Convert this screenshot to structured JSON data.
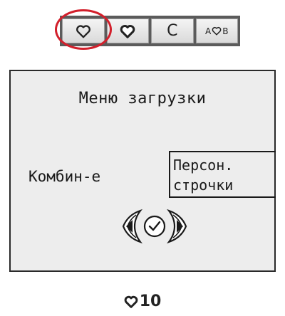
{
  "toolbar": {
    "keys": [
      {
        "icon": "heart-outline-icon"
      },
      {
        "icon": "heart-fill-icon"
      },
      {
        "label": "C"
      },
      {
        "label_left": "A",
        "icon": "heart-outline-icon",
        "label_right": "B"
      }
    ],
    "highlighted_key_index": 0,
    "highlight_color": "#d21f2b"
  },
  "screen": {
    "title": "Меню загрузки",
    "setting_label": "Комбин-е",
    "option_lines": [
      "Персон.",
      "строчки"
    ],
    "nav_icon": "left-right-check-navigation-icon",
    "background": "#ededed"
  },
  "status": {
    "icon": "heart-fill-icon",
    "value": "10"
  }
}
